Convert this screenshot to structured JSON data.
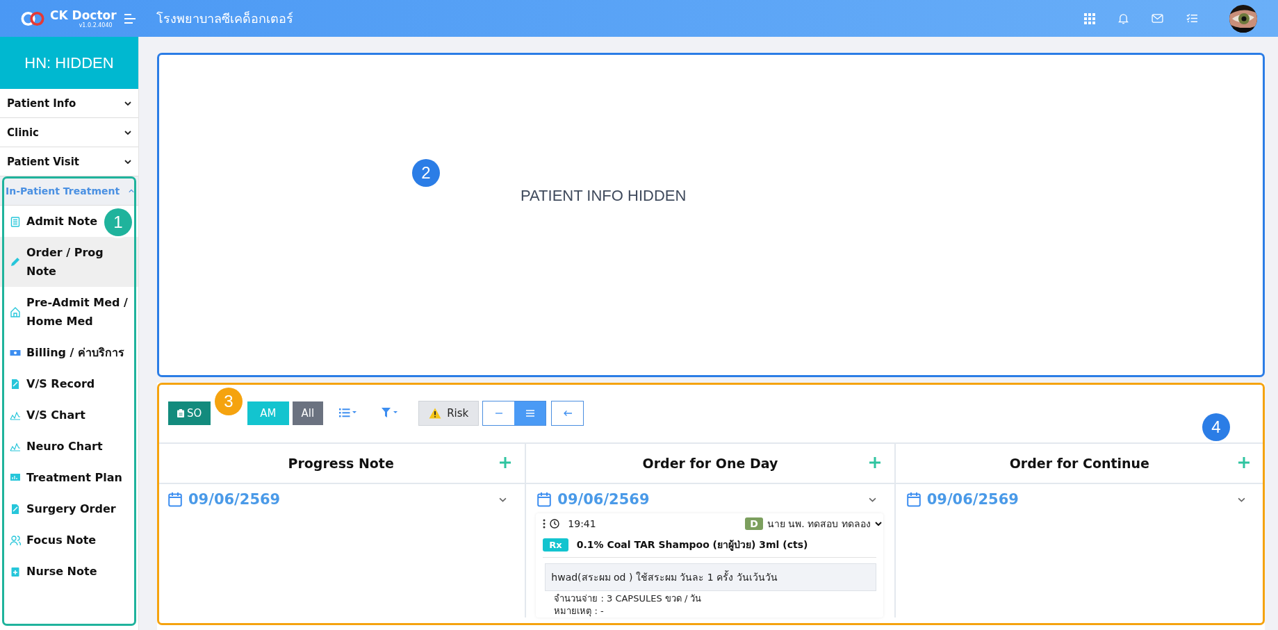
{
  "topbar": {
    "logo": "CK Doctor",
    "version": "v1.0.2.4040",
    "hospital": "โรงพยาบาลซีเคด็อกเตอร์"
  },
  "sidebar": {
    "header": "HN: HIDDEN",
    "sections": [
      {
        "label": "Patient Info",
        "expanded": false
      },
      {
        "label": "Clinic",
        "expanded": false
      },
      {
        "label": "Patient Visit",
        "expanded": false
      },
      {
        "label": "In-Patient Treatment",
        "expanded": true
      }
    ],
    "items": [
      {
        "label": "Admit Note",
        "selected": false
      },
      {
        "label": "Order / Prog Note",
        "selected": true
      },
      {
        "label": "Pre-Admit Med / Home Med",
        "selected": false
      },
      {
        "label": "Billing / ค่าบริการ",
        "selected": false
      },
      {
        "label": "V/S Record",
        "selected": false
      },
      {
        "label": "V/S Chart",
        "selected": false
      },
      {
        "label": "Neuro Chart",
        "selected": false
      },
      {
        "label": "Treatment Plan",
        "selected": false
      },
      {
        "label": "Surgery Order",
        "selected": false
      },
      {
        "label": "Focus Note",
        "selected": false
      },
      {
        "label": "Nurse Note",
        "selected": false
      }
    ]
  },
  "patient_panel": {
    "text": "PATIENT INFO HIDDEN"
  },
  "toolbar": {
    "filters": [
      {
        "label": "SO",
        "kind": "so"
      },
      {
        "label": "AM",
        "kind": "am"
      },
      {
        "label": "All",
        "kind": "all"
      }
    ],
    "risk": "Risk",
    "view_toggle": [
      {
        "selected": false
      },
      {
        "selected": true
      }
    ]
  },
  "columns": [
    {
      "title": "Progress Note",
      "date": "09/06/2569"
    },
    {
      "title": "Order for One Day",
      "date": "09/06/2569",
      "orders": [
        {
          "time": "19:41",
          "role": "D",
          "doctor": "นาย นพ. ทดสอบ ทดลอง",
          "badge": "Rx",
          "drug": "0.1% Coal TAR Shampoo (ยาผู้ป่วย) 3ml (cts)",
          "instruction": "hwad(สระผม od ) ใช้สระผม วันละ 1 ครั้ง วันเว้นวัน",
          "details": [
            "จำนวนจ่าย : 3 CAPSULES ขวด / วัน",
            "หมายเหตุ : -"
          ]
        }
      ]
    },
    {
      "title": "Order for Continue",
      "date": "09/06/2569"
    }
  ],
  "annotations": {
    "frames": [
      {
        "color": "#1fb39c"
      },
      {
        "color": "#2b7de6"
      },
      {
        "color": "#f5a30f"
      }
    ],
    "callouts": [
      {
        "number": "1",
        "color": "#1fb39c"
      },
      {
        "number": "2",
        "color": "#2b7de6"
      },
      {
        "number": "3",
        "color": "#f5a30f"
      },
      {
        "number": "4",
        "color": "#2b7de6"
      }
    ]
  }
}
